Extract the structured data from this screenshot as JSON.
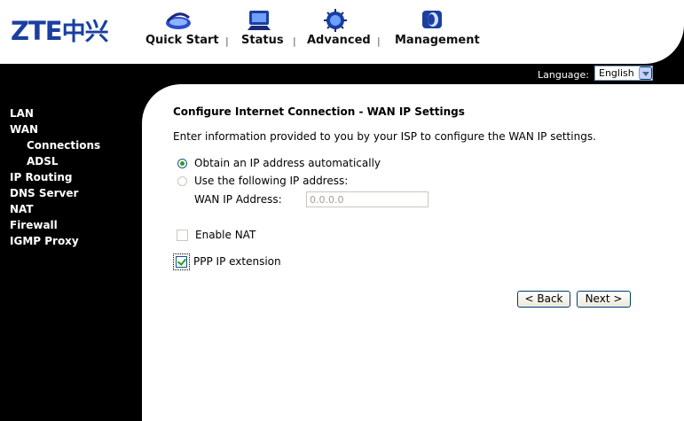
{
  "logo": {
    "latin": "ZTE",
    "chinese": "中兴"
  },
  "nav": [
    {
      "label": "Quick Start",
      "icon": "router-icon"
    },
    {
      "label": "Status",
      "icon": "monitor-icon"
    },
    {
      "label": "Advanced",
      "icon": "chip-icon"
    },
    {
      "label": "Management",
      "icon": "management-icon"
    }
  ],
  "language": {
    "label": "Language:",
    "value": "English"
  },
  "sidebar": {
    "items": [
      {
        "label": "LAN"
      },
      {
        "label": "WAN"
      },
      {
        "label": "Connections"
      },
      {
        "label": "ADSL"
      },
      {
        "label": "IP Routing"
      },
      {
        "label": "DNS Server"
      },
      {
        "label": "NAT"
      },
      {
        "label": "Firewall"
      },
      {
        "label": "IGMP Proxy"
      }
    ]
  },
  "main": {
    "heading": "Configure Internet Connection - WAN IP Settings",
    "description": "Enter information provided to you by your ISP to configure the WAN IP settings.",
    "obtain_auto_label": "Obtain an IP address automatically",
    "use_following_label": "Use the following IP address:",
    "wan_ip_label": "WAN IP Address:",
    "wan_ip_value": "0.0.0.0",
    "enable_nat_label": "Enable NAT",
    "ppp_ip_label": "PPP IP extension",
    "back_label": "< Back",
    "next_label": "Next >"
  },
  "colors": {
    "brand": "#1a3fa0",
    "check": "#21a121"
  }
}
